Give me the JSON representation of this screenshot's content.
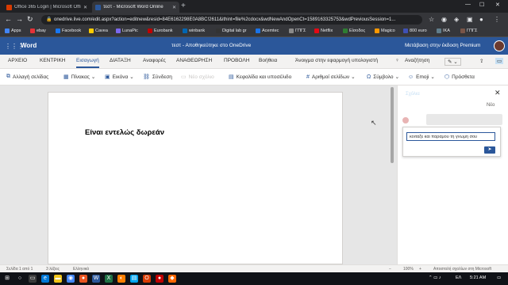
{
  "browser": {
    "tabs": [
      {
        "title": "Office 365 Login | Microsoft Offic",
        "favicon_color": "#d83b01"
      },
      {
        "title": "τεστ - Microsoft Word Online",
        "favicon_color": "#2b579a"
      }
    ],
    "url": "onedrive.live.com/edit.aspx?action=editnew&resid=84E6162298E0A8BC!2611&ithint=file%2cdocx&wdNewAndOpenCt=1589163325753&wdPreviousSession=1...",
    "bookmarks": [
      {
        "label": "Apps",
        "color": "#4285f4"
      },
      {
        "label": "ebay",
        "color": "#e53238"
      },
      {
        "label": "Facebook",
        "color": "#1877f2"
      },
      {
        "label": "Cavea",
        "color": "#ffcc00"
      },
      {
        "label": "LunaPic",
        "color": "#7b68ee"
      },
      {
        "label": "Eurobank",
        "color": "#c00000"
      },
      {
        "label": "winbank",
        "color": "#0066b3"
      },
      {
        "label": "Digital lab gr",
        "color": "#333333"
      },
      {
        "label": "Acemtec",
        "color": "#1a73e8"
      },
      {
        "label": "ΓΠΓΣ",
        "color": "#8a8a8a"
      },
      {
        "label": "Netflix",
        "color": "#e50914"
      },
      {
        "label": "Είσοδος",
        "color": "#2e7d32"
      },
      {
        "label": "Magico",
        "color": "#ff9800"
      },
      {
        "label": "800 euro",
        "color": "#3f51b5"
      },
      {
        "label": "ΙΚΑ",
        "color": "#607d8b"
      },
      {
        "label": "ΓΠΓΣ",
        "color": "#795548"
      }
    ]
  },
  "word": {
    "app_name": "Word",
    "doc_title": "τεστ - Αποθηκεύτηκε στο OneDrive",
    "premium_link": "Μετάβαση στην έκδοση Premium",
    "accent": "#2b579a",
    "ribbon_tabs": [
      "ΑΡΧΕΙΟ",
      "ΚΕΝΤΡΙΚΗ",
      "Εισαγωγή",
      "ΔΙΑΤΑΞΗ",
      "Αναφορές",
      "ΑΝΑΘΕΩΡΗΣΗ",
      "ΠΡΟΒΟΛΗ",
      "Βοήθεια",
      "Άνοιγμα στην εφαρμογή υπολογιστή",
      "Αναζήτηση"
    ],
    "commands": [
      "Αλλαγή σελίδας",
      "Πίνακας",
      "Εικόνα",
      "Σύνδεση",
      "Νέο σχόλιο",
      "Κεφαλίδα και υποσέλιδο",
      "Αριθμοί σελίδων",
      "Σύμβολο",
      "Emoji",
      "Πρόσθετα"
    ],
    "document_text": "Είναι εντελώς δωρεάν",
    "comments_pane": {
      "title_faded": "Σχόλια",
      "new_label": "Νέο",
      "input_value": "κοιταξε και παραμου τη γνωμη σου"
    },
    "status": {
      "page": "Σελίδα 1 από 1",
      "words": "3 λέξεις",
      "language": "Ελληνικά",
      "zoom": "100%",
      "feedback": "Αποστολή σχολίων στη Microsoft"
    }
  },
  "taskbar": {
    "lang": "ΕΛ",
    "time": "5:21 AM"
  }
}
